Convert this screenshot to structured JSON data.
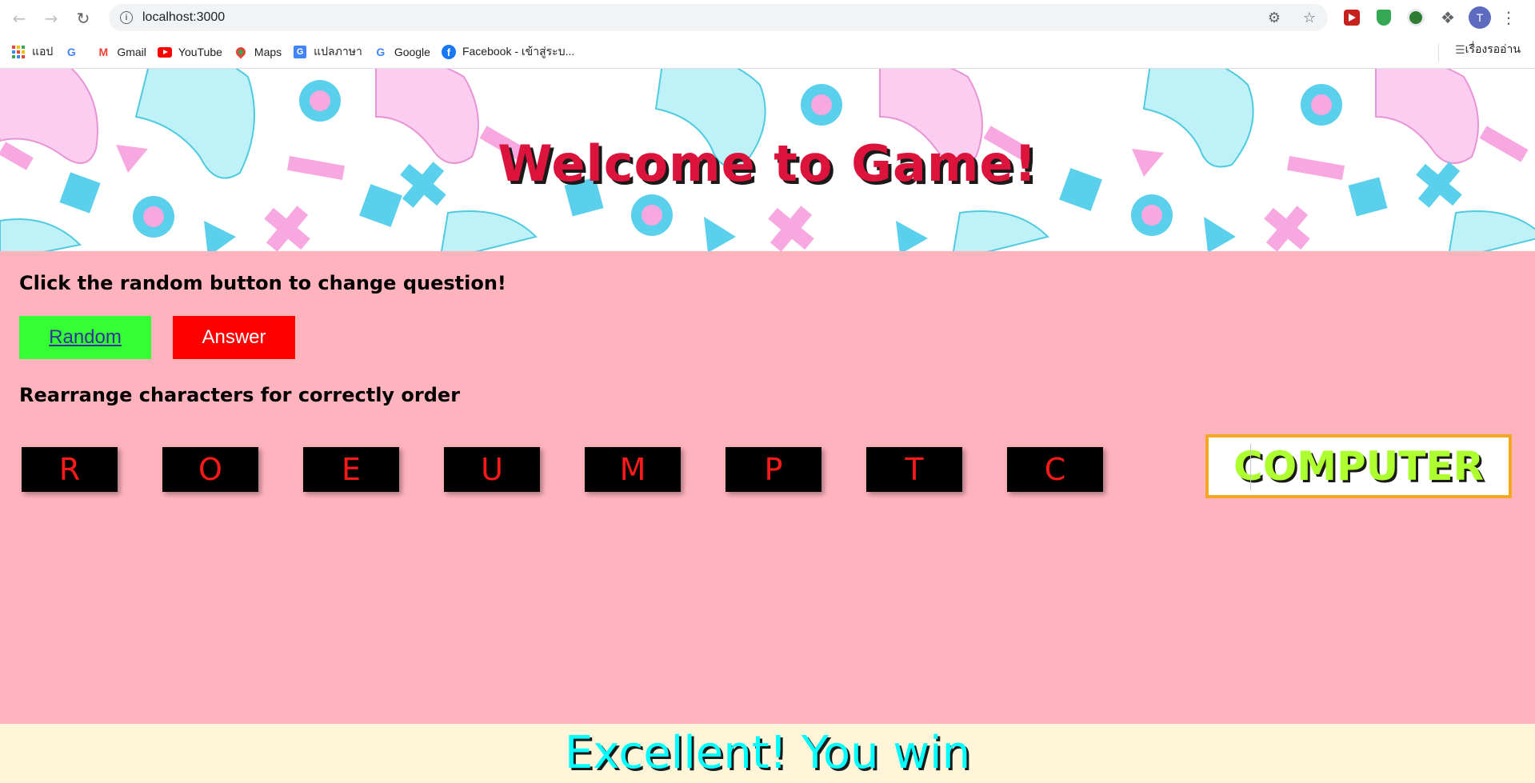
{
  "browser": {
    "url": "localhost:3000",
    "avatar_letter": "T",
    "bookmarks": [
      {
        "label": "แอป",
        "icon": "apps-grid-icon"
      },
      {
        "label": "",
        "icon": "google-icon"
      },
      {
        "label": "Gmail",
        "icon": "gmail-icon"
      },
      {
        "label": "YouTube",
        "icon": "youtube-icon"
      },
      {
        "label": "Maps",
        "icon": "maps-icon"
      },
      {
        "label": "แปลภาษา",
        "icon": "translate-icon"
      },
      {
        "label": "Google",
        "icon": "google-icon"
      },
      {
        "label": "Facebook - เข้าสู่ระบ...",
        "icon": "facebook-icon"
      }
    ],
    "reading_list": "เรื่องรออ่าน"
  },
  "game": {
    "title": "Welcome to Game!",
    "instruction": "Click the random button to change question!",
    "random_label": "Random",
    "answer_label": "Answer",
    "rearrange_instruction": "Rearrange characters for correctly order",
    "letters": [
      "R",
      "O",
      "E",
      "U",
      "M",
      "P",
      "T",
      "C"
    ],
    "answer_value": "COMPUTER",
    "result_message": "Excellent! You win"
  },
  "colors": {
    "page_background": "#ffb3bd",
    "title": "#dc143c",
    "random_button": "#33ff33",
    "answer_button": "#ff0000",
    "tile_background": "#000000",
    "tile_letter": "#ff1a1a",
    "answer_border": "#f5a623",
    "answer_text": "#adff2f",
    "footer_background": "#fff6d9",
    "footer_text": "#00ffff"
  }
}
